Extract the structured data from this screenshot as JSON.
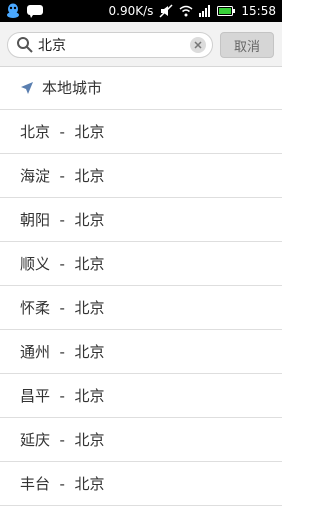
{
  "status_bar": {
    "speed": "0.90K/s",
    "time": "15:58"
  },
  "search": {
    "value": "北京",
    "cancel_label": "取消"
  },
  "location_item": {
    "label": "本地城市"
  },
  "results": [
    {
      "district": "北京",
      "separator": "  -  ",
      "city": "北京"
    },
    {
      "district": "海淀",
      "separator": "  -  ",
      "city": "北京"
    },
    {
      "district": "朝阳",
      "separator": "  -  ",
      "city": "北京"
    },
    {
      "district": "顺义",
      "separator": "  -  ",
      "city": "北京"
    },
    {
      "district": "怀柔",
      "separator": "  -  ",
      "city": "北京"
    },
    {
      "district": "通州",
      "separator": "  -  ",
      "city": "北京"
    },
    {
      "district": "昌平",
      "separator": "  -  ",
      "city": "北京"
    },
    {
      "district": "延庆",
      "separator": "  -  ",
      "city": "北京"
    },
    {
      "district": "丰台",
      "separator": "  -  ",
      "city": "北京"
    }
  ]
}
